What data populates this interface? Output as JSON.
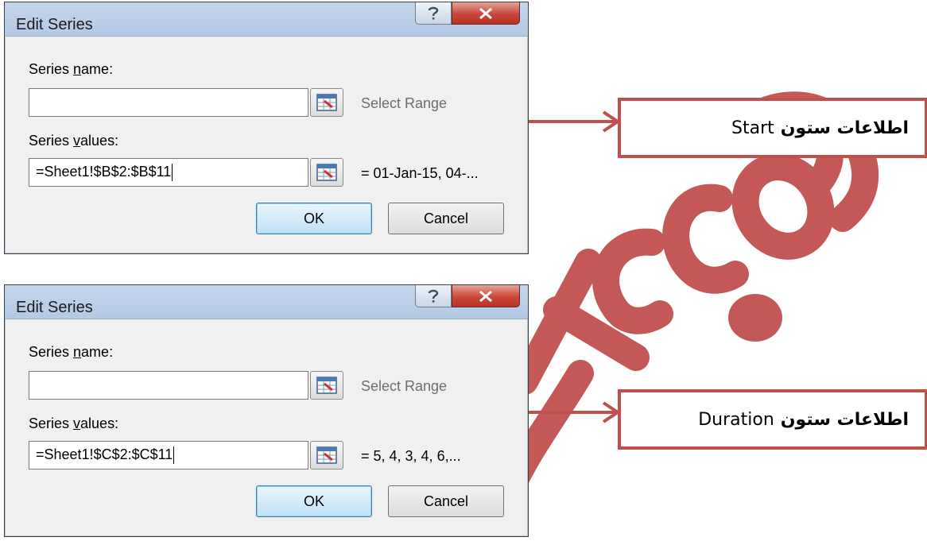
{
  "dialogs": [
    {
      "title": "Edit Series",
      "name_label_pre": "Series ",
      "name_label_u": "n",
      "name_label_post": "ame:",
      "name_value": "",
      "name_preview": "Select Range",
      "values_label_pre": "Series ",
      "values_label_u": "v",
      "values_label_post": "alues:",
      "values_value": "=Sheet1!$B$2:$B$11",
      "values_preview": "= 01-Jan-15, 04-...",
      "ok_label": "OK",
      "cancel_label": "Cancel",
      "help_glyph": "?",
      "close_glyph": "X"
    },
    {
      "title": "Edit Series",
      "name_label_pre": "Series ",
      "name_label_u": "n",
      "name_label_post": "ame:",
      "name_value": "",
      "name_preview": "Select Range",
      "values_label_pre": "Series ",
      "values_label_u": "v",
      "values_label_post": "alues:",
      "values_value": "=Sheet1!$C$2:$C$11",
      "values_preview": "= 5, 4, 3, 4, 6,...",
      "ok_label": "OK",
      "cancel_label": "Cancel",
      "help_glyph": "?",
      "close_glyph": "X"
    }
  ],
  "callouts": [
    {
      "persian": "اطلاعات ستون",
      "english": "Start"
    },
    {
      "persian": "اطلاعات ستون",
      "english": "Duration"
    }
  ],
  "watermark": {
    "text": "...khah.com",
    "color": "#c0504d"
  },
  "colors": {
    "accent_red": "#c0504d",
    "titlebar": "#b9cde6",
    "dialog_bg": "#f0f0f0",
    "close_button": "#c9473a",
    "ok_button": "#bfe1f6"
  },
  "icons": {
    "help": "question-mark-icon",
    "close": "close-icon",
    "range_selector": "range-select-icon",
    "arrow": "arrow-right-icon"
  }
}
